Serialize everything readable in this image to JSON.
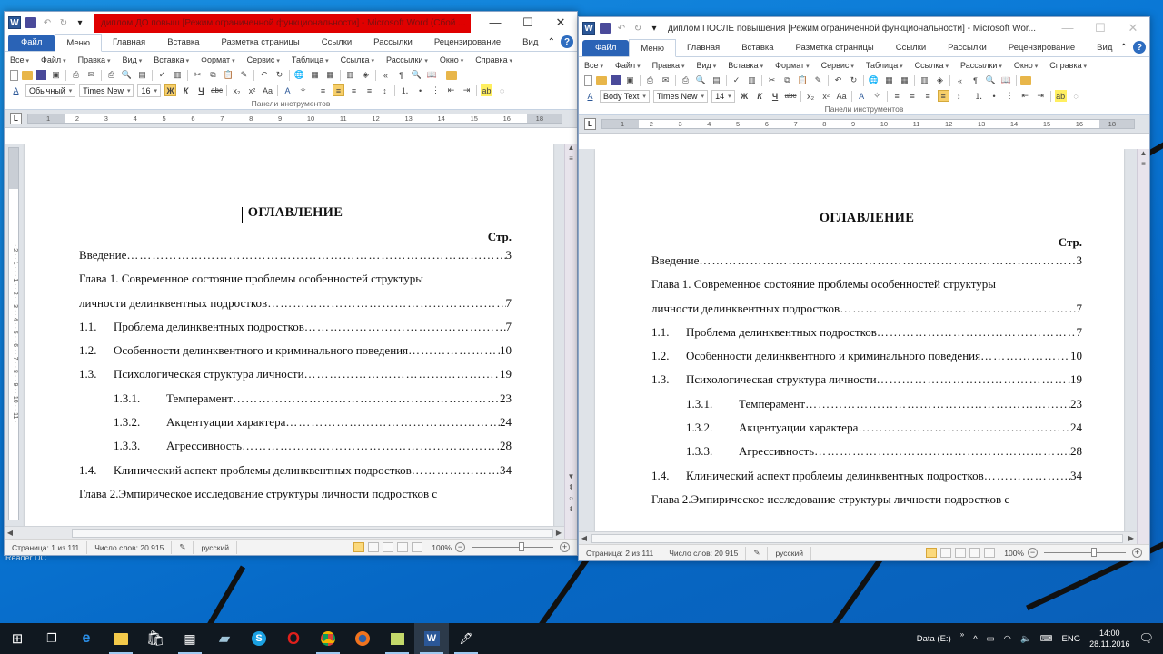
{
  "desktop": {
    "reader_label": "Reader DC"
  },
  "windows": [
    {
      "title": "диплом ДО повыш [Режим ограниченной функциональности] - Microsoft Word (Сбой ...",
      "tabs": [
        "Файл",
        "Меню",
        "Главная",
        "Вставка",
        "Разметка страницы",
        "Ссылки",
        "Рассылки",
        "Рецензирование",
        "Вид"
      ],
      "active_tab": "Меню",
      "menus": [
        "Все",
        "Файл",
        "Правка",
        "Вид",
        "Вставка",
        "Формат",
        "Сервис",
        "Таблица",
        "Ссылка",
        "Рассылки",
        "Окно",
        "Справка"
      ],
      "style": "Обычный",
      "font": "Times New",
      "size": "16",
      "panel_label": "Панели инструментов",
      "ruler_marks": [
        "1",
        "2",
        "3",
        "4",
        "5",
        "6",
        "7",
        "8",
        "9",
        "10",
        "11",
        "12",
        "13",
        "14",
        "15",
        "16",
        "18"
      ],
      "status": {
        "page": "Страница: 1 из 111",
        "words": "Число слов: 20 915",
        "lang": "русский",
        "zoom": "100%"
      },
      "zoom_level_percent": 100
    },
    {
      "title": "диплом ПОСЛЕ повышения [Режим ограниченной функциональности] - Microsoft Wor...",
      "tabs": [
        "Файл",
        "Меню",
        "Главная",
        "Вставка",
        "Разметка страницы",
        "Ссылки",
        "Рассылки",
        "Рецензирование",
        "Вид"
      ],
      "active_tab": "Меню",
      "menus": [
        "Все",
        "Файл",
        "Правка",
        "Вид",
        "Вставка",
        "Формат",
        "Сервис",
        "Таблица",
        "Ссылка",
        "Рассылки",
        "Окно",
        "Справка"
      ],
      "style": "Body Text",
      "font": "Times New",
      "size": "14",
      "panel_label": "Панели инструментов",
      "ruler_marks": [
        "1",
        "2",
        "3",
        "4",
        "5",
        "6",
        "7",
        "8",
        "9",
        "10",
        "11",
        "12",
        "13",
        "14",
        "15",
        "16",
        "18"
      ],
      "status": {
        "page": "Страница: 2 из 111",
        "words": "Число слов: 20 915",
        "lang": "русский",
        "zoom": "100%"
      },
      "zoom_level_percent": 100
    }
  ],
  "document": {
    "heading": "ОГЛАВЛЕНИЕ",
    "page_header": "Стр.",
    "toc": [
      {
        "level": 1,
        "num": "",
        "text": "Введение ",
        "page": "3"
      },
      {
        "level": 1,
        "num": "",
        "text": "Глава 1. Современное состояние проблемы особенностей структуры",
        "page": "",
        "wrap": true
      },
      {
        "level": 1,
        "num": "",
        "text": "личности делинквентных подростков",
        "page": "7"
      },
      {
        "level": 2,
        "num": "1.1.",
        "text": "Проблема делинквентных подростков",
        "page": "7"
      },
      {
        "level": 2,
        "num": "1.2.",
        "text": "Особенности делинквентного и криминального поведения",
        "page": "10"
      },
      {
        "level": 2,
        "num": "1.3.",
        "text": "Психологическая структура личности",
        "page": "19"
      },
      {
        "level": 3,
        "num": "1.3.1.",
        "text": "Темперамент",
        "page": "23"
      },
      {
        "level": 3,
        "num": "1.3.2.",
        "text": "Акцентуации характера",
        "page": "24"
      },
      {
        "level": 3,
        "num": "1.3.3.",
        "text": "Агрессивность",
        "page": "28"
      },
      {
        "level": 2,
        "num": "1.4.",
        "text": "Клинический аспект проблемы делинквентных подростков",
        "page": "34"
      },
      {
        "level": 1,
        "num": "",
        "text": "Глава 2.Эмпирическое исследование структуры личности подростков с",
        "page": "",
        "wrap": true
      }
    ]
  },
  "taskbar": {
    "apps": [
      "start",
      "task-view",
      "edge",
      "file-explorer",
      "store",
      "calculator",
      "notepad",
      "skype",
      "opera",
      "chrome",
      "firefox",
      "sticky",
      "word",
      "other"
    ],
    "tray": {
      "drive": "Data (E:)",
      "lang": "ENG",
      "time": "14:00",
      "date": "28.11.2016"
    }
  }
}
